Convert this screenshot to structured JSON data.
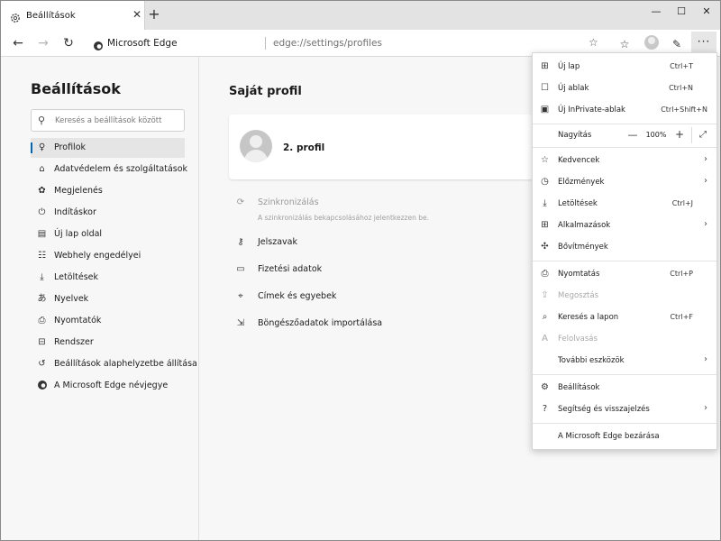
{
  "tab": {
    "title": "Beállítások",
    "close": "✕",
    "new_tab": "+"
  },
  "window_controls": {
    "minimize": "—",
    "maximize": "☐",
    "close": "✕"
  },
  "address": {
    "site_label": "Microsoft Edge",
    "url": "edge://settings/profiles"
  },
  "sidebar": {
    "title": "Beállítások",
    "search_placeholder": "Keresés a beállítások között",
    "items": [
      {
        "label": "Profilok",
        "icon": "person-icon",
        "active": true
      },
      {
        "label": "Adatvédelem és szolgáltatások",
        "icon": "lock-icon"
      },
      {
        "label": "Megjelenés",
        "icon": "palette-icon"
      },
      {
        "label": "Indításkor",
        "icon": "power-icon"
      },
      {
        "label": "Új lap oldal",
        "icon": "new-tab-page-icon"
      },
      {
        "label": "Webhely engedélyei",
        "icon": "site-permissions-icon"
      },
      {
        "label": "Letöltések",
        "icon": "download-icon"
      },
      {
        "label": "Nyelvek",
        "icon": "languages-icon"
      },
      {
        "label": "Nyomtatók",
        "icon": "printer-icon"
      },
      {
        "label": "Rendszer",
        "icon": "system-icon"
      },
      {
        "label": "Beállítások alaphelyzetbe állítása",
        "icon": "reset-icon"
      },
      {
        "label": "A Microsoft Edge névjegye",
        "icon": "edge-logo-icon"
      }
    ]
  },
  "main": {
    "title": "Saját profil",
    "profile_name": "2. profil",
    "sync": {
      "label": "Szinkronizálás",
      "sub": "A szinkronizálás bekapcsolásához jelentkezzen be."
    },
    "rows": [
      {
        "label": "Jelszavak",
        "icon": "key-icon"
      },
      {
        "label": "Fizetési adatok",
        "icon": "card-icon"
      },
      {
        "label": "Címek és egyebek",
        "icon": "location-icon"
      },
      {
        "label": "Böngészőadatok importálása",
        "icon": "import-icon"
      }
    ]
  },
  "menu": {
    "items": [
      {
        "label": "Új lap",
        "shortcut": "Ctrl+T",
        "icon": "new-tab-icon"
      },
      {
        "label": "Új ablak",
        "shortcut": "Ctrl+N",
        "icon": "new-window-icon"
      },
      {
        "label": "Új InPrivate-ablak",
        "shortcut": "Ctrl+Shift+N",
        "icon": "inprivate-icon"
      },
      {
        "label": "Nagyítás",
        "zoom": "100%",
        "icon": ""
      },
      {
        "label": "Kedvencek",
        "icon": "favorites-icon",
        "submenu": true
      },
      {
        "label": "Előzmények",
        "icon": "history-icon",
        "submenu": true
      },
      {
        "label": "Letöltések",
        "shortcut": "Ctrl+J",
        "icon": "download-icon"
      },
      {
        "label": "Alkalmazások",
        "icon": "apps-icon",
        "submenu": true
      },
      {
        "label": "Bővítmények",
        "icon": "extensions-icon"
      },
      {
        "label": "Nyomtatás",
        "shortcut": "Ctrl+P",
        "icon": "print-icon"
      },
      {
        "label": "Megosztás",
        "icon": "share-icon",
        "disabled": true
      },
      {
        "label": "Keresés a lapon",
        "shortcut": "Ctrl+F",
        "icon": "find-icon"
      },
      {
        "label": "Felolvasás",
        "icon": "read-aloud-icon",
        "disabled": true
      },
      {
        "label": "További eszközök",
        "icon": "",
        "submenu": true
      },
      {
        "label": "Beállítások",
        "icon": "settings-icon"
      },
      {
        "label": "Segítség és visszajelzés",
        "icon": "help-icon",
        "submenu": true
      },
      {
        "label": "A Microsoft Edge bezárása",
        "icon": ""
      }
    ],
    "zoom_minus": "—",
    "zoom_plus": "+"
  }
}
